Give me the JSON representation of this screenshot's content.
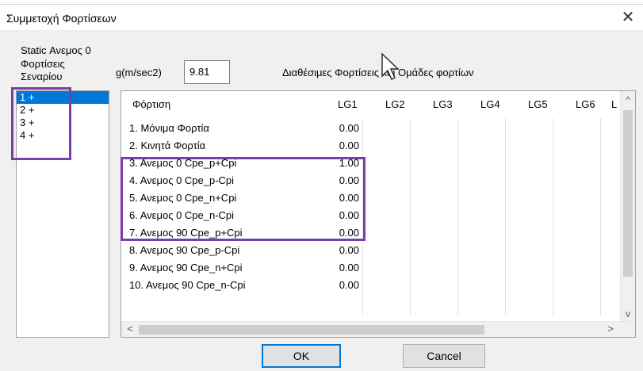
{
  "window": {
    "title": "Συμμετοχή Φορτίσεων"
  },
  "labels": {
    "static_wind": "Static Ανεμος 0",
    "scenario_loads_line1": "Φορτίσεις",
    "scenario_loads_line2": "Σεναρίου",
    "gravity": "g(m/sec2)",
    "available": "Διαθέσιμες Φορτίσεις και Ομάδες φορτίων"
  },
  "gravity_value": "9.81",
  "scenarios": [
    "1 +",
    "2 +",
    "3 +",
    "4 +"
  ],
  "table": {
    "columns": [
      "Φόρτιση",
      "LG1",
      "LG2",
      "LG3",
      "LG4",
      "LG5",
      "LG6",
      "L"
    ],
    "rows": [
      {
        "name": "1. Μόνιμα Φορτία",
        "lg1": "0.00"
      },
      {
        "name": "2. Κινητά Φορτία",
        "lg1": "0.00"
      },
      {
        "name": "3. Ανεμος 0 Cpe_p+Cpi",
        "lg1": "1.00"
      },
      {
        "name": "4. Ανεμος 0 Cpe_p-Cpi",
        "lg1": "0.00"
      },
      {
        "name": "5. Ανεμος 0 Cpe_n+Cpi",
        "lg1": "0.00"
      },
      {
        "name": "6. Ανεμος 0 Cpe_n-Cpi",
        "lg1": "0.00"
      },
      {
        "name": "7. Ανεμος 90 Cpe_p+Cpi",
        "lg1": "0.00"
      },
      {
        "name": "8. Ανεμος 90 Cpe_p-Cpi",
        "lg1": "0.00"
      },
      {
        "name": "9. Ανεμος 90 Cpe_n+Cpi",
        "lg1": "0.00"
      },
      {
        "name": "10. Ανεμος 90 Cpe_n-Cpi",
        "lg1": "0.00"
      }
    ]
  },
  "buttons": {
    "ok": "OK",
    "cancel": "Cancel"
  },
  "colors": {
    "selection": "#0078d7",
    "highlight": "#7b3ea6"
  },
  "icons": {
    "close": "close-icon",
    "cursor": "cursor-arrow-icon"
  }
}
